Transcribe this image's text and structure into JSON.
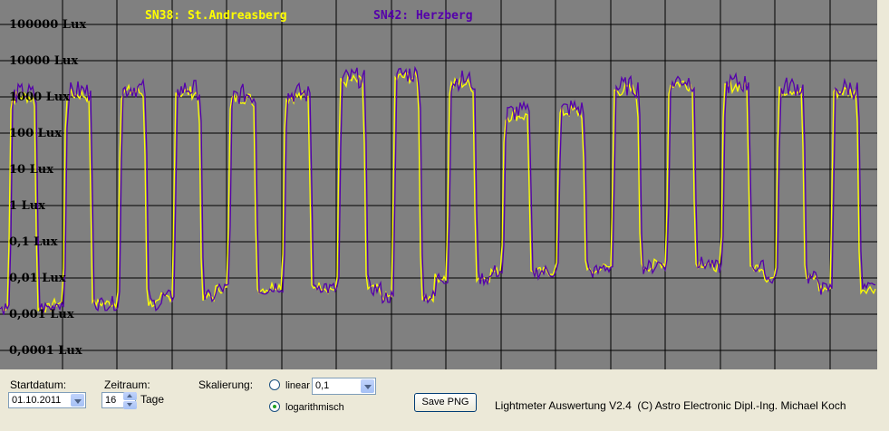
{
  "chart_data": {
    "type": "line",
    "legend": [
      "SN38: St.Andreasberg",
      "SN42: Herzberg"
    ],
    "colors": {
      "series_1": "#ffff00",
      "series_2": "#5500aa",
      "background": "#808080",
      "grid": "#000000"
    },
    "y_scale": "log",
    "ylim": [
      0.0001,
      100000
    ],
    "y_tick_labels": [
      "100000 Lux",
      "10000 Lux",
      "1000 Lux",
      "100 Lux",
      "10 Lux",
      "1 Lux",
      "0,1 Lux",
      "0,01 Lux",
      "0,001 Lux",
      "0,0001 Lux"
    ],
    "grid": true,
    "days": 16,
    "start_date": "01.10.2011",
    "daily": [
      {
        "day": 1,
        "peak": 1300,
        "night": 0.0015
      },
      {
        "day": 2,
        "peak": 1500,
        "night": 0.002
      },
      {
        "day": 3,
        "peak": 1800,
        "night": 0.002
      },
      {
        "day": 4,
        "peak": 1700,
        "night": 0.003
      },
      {
        "day": 5,
        "peak": 1200,
        "night": 0.005
      },
      {
        "day": 6,
        "peak": 1300,
        "night": 0.006
      },
      {
        "day": 7,
        "peak": 3500,
        "night": 0.005
      },
      {
        "day": 8,
        "peak": 4500,
        "night": 0.003
      },
      {
        "day": 9,
        "peak": 3000,
        "night": 0.01
      },
      {
        "day": 10,
        "peak": 400,
        "night": 0.015
      },
      {
        "day": 11,
        "peak": 500,
        "night": 0.015
      },
      {
        "day": 12,
        "peak": 2000,
        "night": 0.02
      },
      {
        "day": 13,
        "peak": 3000,
        "night": 0.025
      },
      {
        "day": 14,
        "peak": 2500,
        "night": 0.02
      },
      {
        "day": 15,
        "peak": 2000,
        "night": 0.01
      },
      {
        "day": 16,
        "peak": 1800,
        "night": 0.005
      }
    ]
  },
  "controls": {
    "start_label": "Startdatum:",
    "start_value": "01.10.2011",
    "range_label": "Zeitraum:",
    "range_value": "16",
    "range_unit": "Tage",
    "scale_label": "Skalierung:",
    "linear_label": "linear",
    "linear_value": "0,1",
    "log_label": "logarithmisch",
    "selected_scale": "logarithmisch",
    "save_button": "Save PNG",
    "credit": "Lightmeter Auswertung V2.4  (C) Astro Electronic Dipl.-Ing. Michael Koch"
  }
}
